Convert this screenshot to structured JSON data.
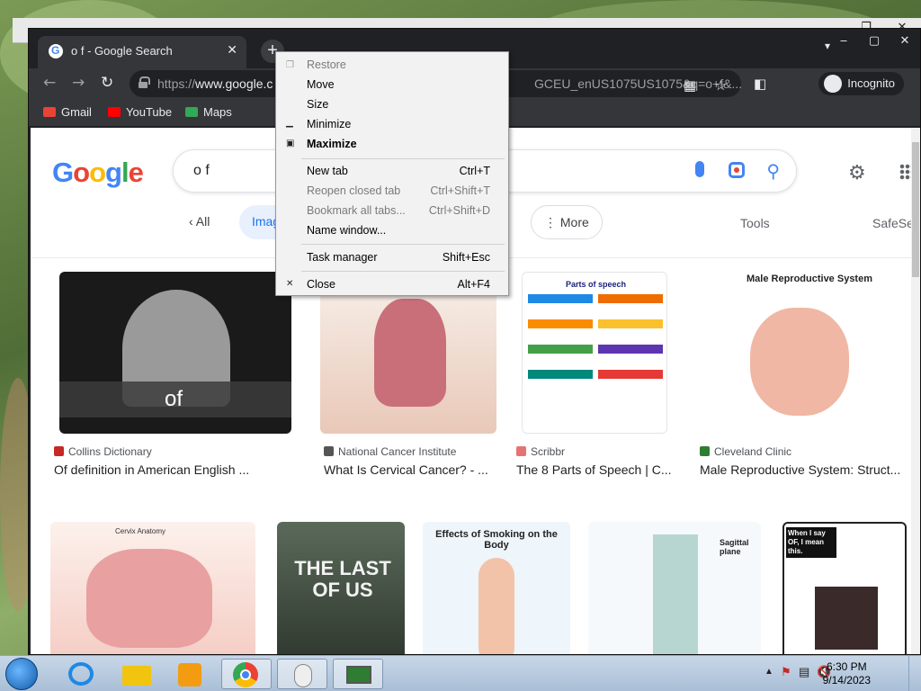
{
  "browser": {
    "tab_title": "o f - Google Search",
    "url_prefix": "https://",
    "url_host": "www.google.c",
    "url_rest": "GCEU_enUS1075US1075&q=o+f&...",
    "profile_label": "Incognito",
    "bookmarks": [
      {
        "label": "Gmail",
        "color": "#ea4335"
      },
      {
        "label": "YouTube",
        "color": "#ff0000"
      },
      {
        "label": "Maps",
        "color": "#34a853"
      }
    ]
  },
  "search": {
    "query": "o f",
    "chips": {
      "all": "All",
      "images": "Imag",
      "more": "More"
    },
    "tools": "Tools",
    "safesearch": "SafeSe"
  },
  "results_row1": [
    {
      "source": "Collins Dictionary",
      "title": "Of definition in American English ...",
      "thumb_text": "of",
      "fav": "#c62828"
    },
    {
      "source": "National Cancer Institute",
      "title": "What Is Cervical Cancer? - ...",
      "fav": "#555555"
    },
    {
      "source": "Scribbr",
      "title": "The 8 Parts of Speech | C...",
      "thumb_text": "Parts of speech",
      "fav": "#e57373"
    },
    {
      "source": "Cleveland Clinic",
      "title": "Male Reproductive System: Struct...",
      "thumb_text": "Male Reproductive System",
      "fav": "#2e7d32"
    }
  ],
  "results_row2": [
    {
      "thumb_text": "Cervix Anatomy"
    },
    {
      "thumb_text": "THE LAST OF US"
    },
    {
      "thumb_text": "Effects of Smoking on the Body"
    },
    {
      "thumb_text": "Sagittal plane"
    },
    {
      "thumb_text": "When I say OF, I mean this."
    }
  ],
  "system_menu": {
    "restore": "Restore",
    "move": "Move",
    "size": "Size",
    "minimize": "Minimize",
    "maximize": "Maximize",
    "new_tab": "New tab",
    "new_tab_key": "Ctrl+T",
    "reopen": "Reopen closed tab",
    "reopen_key": "Ctrl+Shift+T",
    "bookmark_all": "Bookmark all tabs...",
    "bookmark_all_key": "Ctrl+Shift+D",
    "name_window": "Name window...",
    "task_manager": "Task manager",
    "task_manager_key": "Shift+Esc",
    "close": "Close",
    "close_key": "Alt+F4"
  },
  "taskbar": {
    "time": "6:30 PM",
    "date": "9/14/2023"
  }
}
